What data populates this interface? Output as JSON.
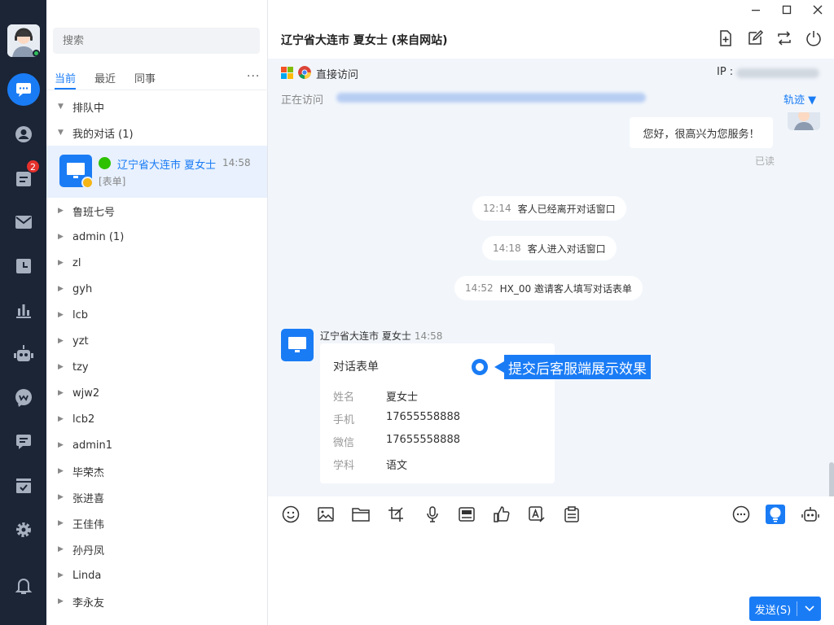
{
  "rail": {
    "notifications_badge": "2",
    "nav_items": [
      "chat",
      "contacts",
      "tickets",
      "mail",
      "history",
      "stats",
      "robot",
      "wechat",
      "messages",
      "forms",
      "settings",
      "alerts"
    ]
  },
  "list": {
    "search_placeholder": "搜索",
    "tabs": [
      {
        "label": "当前",
        "active": true
      },
      {
        "label": "最近",
        "active": false
      },
      {
        "label": "同事",
        "active": false
      }
    ],
    "more_label": "···",
    "groups": {
      "queue": "排队中",
      "mine": "我的对话  (1)"
    },
    "active_chat": {
      "name": "辽宁省大连市 夏女士",
      "time": "14:58",
      "sub": "[表单]"
    },
    "colleagues": [
      "鲁班七号",
      "admin  (1)",
      "zl",
      "gyh",
      "lcb",
      "yzt",
      "tzy",
      "wjw2",
      "lcb2",
      "admin1",
      "毕荣杰",
      "张进喜",
      "王佳伟",
      "孙丹凤",
      "Linda",
      "李永友"
    ]
  },
  "header": {
    "title": "辽宁省大连市 夏女士 (来自网站)"
  },
  "visit": {
    "source": "直接访问",
    "ip_label": "IP :",
    "visiting_label": "正在访问",
    "track_label": "轨迹"
  },
  "messages": {
    "agent_reply": "您好，很高兴为您服务！",
    "read_status": "已读",
    "system": [
      {
        "time": "12:14",
        "text": "客人已经离开对话窗口"
      },
      {
        "time": "14:18",
        "text": "客人进入对话窗口"
      },
      {
        "time": "14:52",
        "text": "HX_00 邀请客人填写对话表单"
      }
    ],
    "customer_name": "辽宁省大连市 夏女士",
    "customer_time": "14:58",
    "form": {
      "title": "对话表单",
      "fields": [
        {
          "key": "姓名",
          "value": "夏女士"
        },
        {
          "key": "手机",
          "value": "17655558888"
        },
        {
          "key": "微信",
          "value": "17655558888"
        },
        {
          "key": "学科",
          "value": "语文"
        }
      ]
    },
    "annotation": "提交后客服端展示效果"
  },
  "composer": {
    "send_label": "发送(S)"
  },
  "colors": {
    "accent": "#1a7cf5",
    "rail": "#1b2536",
    "badge": "#e5302c"
  }
}
